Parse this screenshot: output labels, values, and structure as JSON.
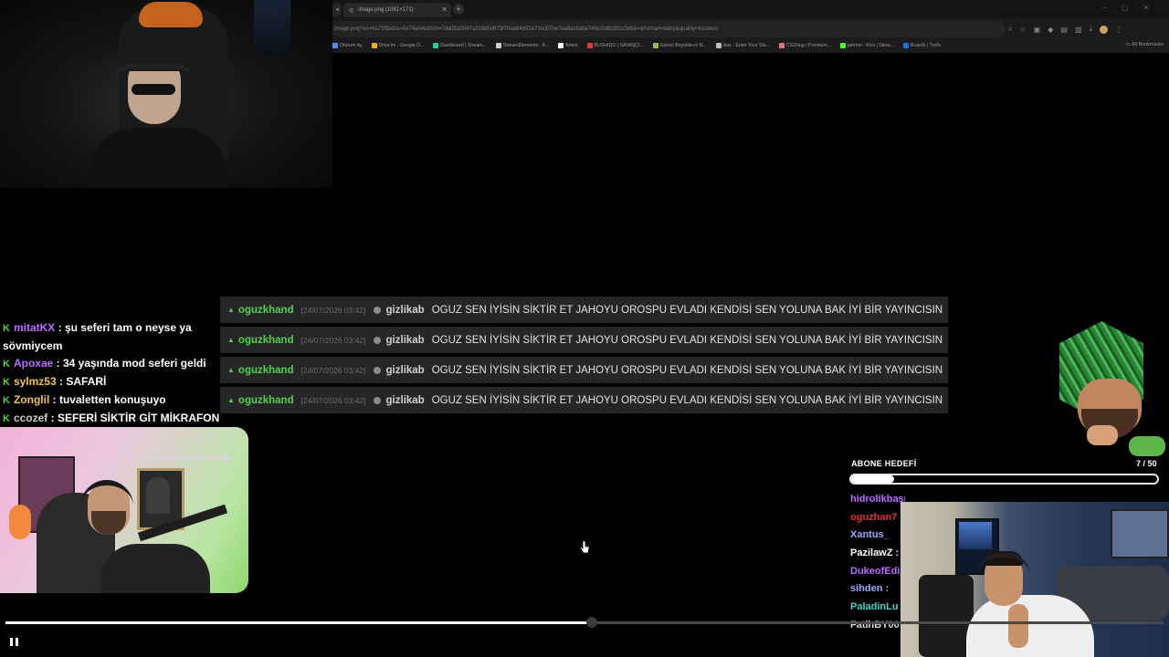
{
  "browser": {
    "tab_title": "image.png (1061×171)",
    "url": "image.png?ex=6a75f5e&is=6a74ad4e&hm=7da02a3847a219d5d673f70ea64b92e73cc67be7ea8acbabe749c0b8b351c5d6&=&format=webp&quality=lossless",
    "bookmarks": [
      {
        "label": "Oturum Aç",
        "color": "#4a8bf5"
      },
      {
        "label": "Drive'ım - Google D...",
        "color": "#f4b400"
      },
      {
        "label": "Dashboard | Stream...",
        "color": "#12d6a0"
      },
      {
        "label": "StreamElements - A...",
        "color": "#cccccc"
      },
      {
        "label": "Botrix",
        "color": "#ffffff"
      },
      {
        "label": "BUSHIDO | SAVAŞÇI...",
        "color": "#e53935"
      },
      {
        "label": "Görsel Boyutlarını N...",
        "color": "#8bc34a"
      },
      {
        "label": "ikas - Enter Your Sto...",
        "color": "#bbbbbb"
      },
      {
        "label": "CS2Hug | Premium...",
        "color": "#e57373"
      },
      {
        "label": "jahrein - Kick | Strea...",
        "color": "#53fc18"
      },
      {
        "label": "Boards | Trello",
        "color": "#1e6fd9"
      }
    ],
    "all_bookmarks_label": "All Bookmarks"
  },
  "overlay_messages": [
    {
      "user": "oguzkhand",
      "time": "[24/07/2026 03:42]",
      "author": "gizlikab",
      "text": "OGUZ SEN İYİSİN SİKTİR ET JAHOYU OROSPU EVLADI KENDİSİ SEN YOLUNA BAK İYİ BİR YAYINCISIN"
    },
    {
      "user": "oguzkhand",
      "time": "[24/07/2026 03:42]",
      "author": "gizlikab",
      "text": "OGUZ SEN İYİSİN SİKTİR ET JAHOYU OROSPU EVLADI KENDİSİ SEN YOLUNA BAK İYİ BİR YAYINCISIN"
    },
    {
      "user": "oguzkhand",
      "time": "[24/07/2026 03:42]",
      "author": "gizlikab",
      "text": "OGUZ SEN İYİSİN SİKTİR ET JAHOYU OROSPU EVLADI KENDİSİ SEN YOLUNA BAK İYİ BİR YAYINCISIN"
    },
    {
      "user": "oguzkhand",
      "time": "[24/07/2026 03:42]",
      "author": "gizlikab",
      "text": "OGUZ SEN İYİSİN SİKTİR ET JAHOYU OROSPU EVLADI KENDİSİ SEN YOLUNA BAK İYİ BİR YAYINCISIN"
    }
  ],
  "left_chat": [
    {
      "badge": "K",
      "name": "mitatKX",
      "color": "#b86bff",
      "text": " : şu seferi tam o neyse ya sövmiycem"
    },
    {
      "badge": "K",
      "name": "Apoxae",
      "color": "#b86bff",
      "text": " : 34 yaşında mod seferi geldi"
    },
    {
      "badge": "K",
      "name": "sylmz53",
      "color": "#f4c542",
      "text": " : SAFARİ"
    },
    {
      "badge": "K",
      "name": "Zonglil",
      "color": "#f4c542",
      "text": " : tuvaletten konuşuyo"
    },
    {
      "badge": "K",
      "name": "ccozef",
      "color": "#cccccc",
      "text": " : SEFERİ SİKTİR GİT MİKRAFON AL AQ"
    }
  ],
  "sub_goal": {
    "title": "ABONE HEDEFİ",
    "count_label": "7 / 50",
    "current": 7,
    "target": 50
  },
  "right_chat": [
    {
      "name": "hidrolikbasinc :",
      "color": "#b86bff"
    },
    {
      "name": "oguzhan7",
      "color": "#e0303a"
    },
    {
      "name": "Xantus_",
      "color": "#9aa8ff"
    },
    {
      "name": "PazilawZ :",
      "color": "#ffffff"
    },
    {
      "name": "DukeofEdi",
      "color": "#b86bff"
    },
    {
      "name": "sihden :",
      "color": "#9aa8ff"
    },
    {
      "name": "PaladinLu",
      "color": "#3fd0c9"
    },
    {
      "name": "FatihBY00",
      "color": "#dddddd"
    }
  ],
  "player": {
    "progress": 0.505,
    "state": "playing"
  },
  "colors": {
    "accent_green": "#52d14a",
    "overlay_row": "#2a2a2d"
  }
}
